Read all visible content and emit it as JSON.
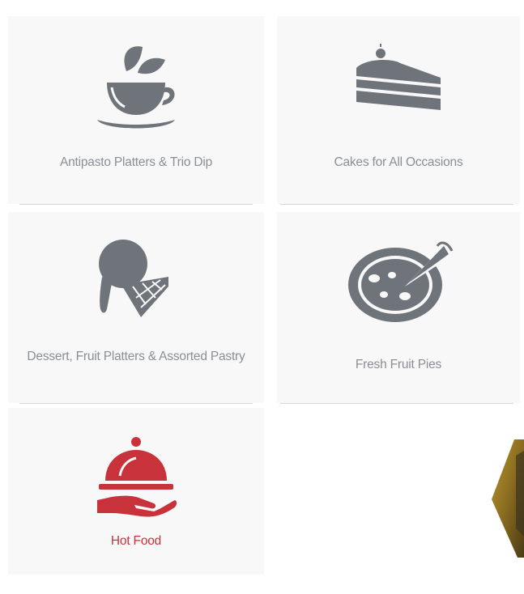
{
  "categories": [
    {
      "label": "Antipasto Platters & Trio Dip",
      "icon": "tea-cup-icon",
      "active": false
    },
    {
      "label": "Cakes for All Occasions",
      "icon": "cake-slice-icon",
      "active": false
    },
    {
      "label": "Dessert, Fruit Platters & Assorted Pastry",
      "icon": "ice-cream-cone-icon",
      "active": false
    },
    {
      "label": "Fresh Fruit Pies",
      "icon": "pie-icon",
      "active": false
    },
    {
      "label": "Hot Food",
      "icon": "serving-cloche-icon",
      "active": true
    }
  ],
  "colors": {
    "icon_gray": "#6f747a",
    "label_gray": "#8a8f96",
    "active_red": "#c8333b",
    "card_bg": "#f8f8f8"
  }
}
